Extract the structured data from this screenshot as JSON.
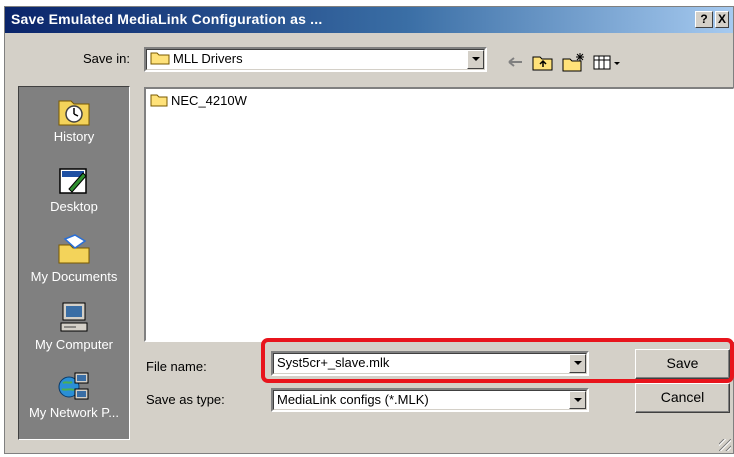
{
  "dialog": {
    "title": "Save Emulated MediaLink Configuration as ...",
    "help_glyph": "?",
    "close_glyph": "X"
  },
  "toolbar": {
    "save_in_label": "Save in:",
    "save_in_value": "MLL Drivers",
    "icons": [
      "back-arrow-icon",
      "up-one-level-icon",
      "create-new-folder-icon",
      "view-menu-icon"
    ]
  },
  "places_bar": {
    "items": [
      {
        "label": "History",
        "icon": "history-icon"
      },
      {
        "label": "Desktop",
        "icon": "desktop-icon"
      },
      {
        "label": "My Documents",
        "icon": "my-documents-icon"
      },
      {
        "label": "My Computer",
        "icon": "my-computer-icon"
      },
      {
        "label": "My Network P...",
        "icon": "my-network-places-icon"
      }
    ]
  },
  "file_list": {
    "items": [
      {
        "name": "NEC_4210W",
        "icon": "folder-icon"
      }
    ]
  },
  "form": {
    "file_name_label": "File name:",
    "file_name_value": "Syst5cr+_slave.mlk",
    "save_as_type_label": "Save as type:",
    "save_as_type_value": "MediaLink configs (*.MLK)"
  },
  "buttons": {
    "save": "Save",
    "cancel": "Cancel"
  },
  "colors": {
    "title_bar_start": "#0a246a",
    "title_bar_end": "#a6caf0",
    "highlight": "#e8141c",
    "dialog_face": "#d4d0c8"
  }
}
